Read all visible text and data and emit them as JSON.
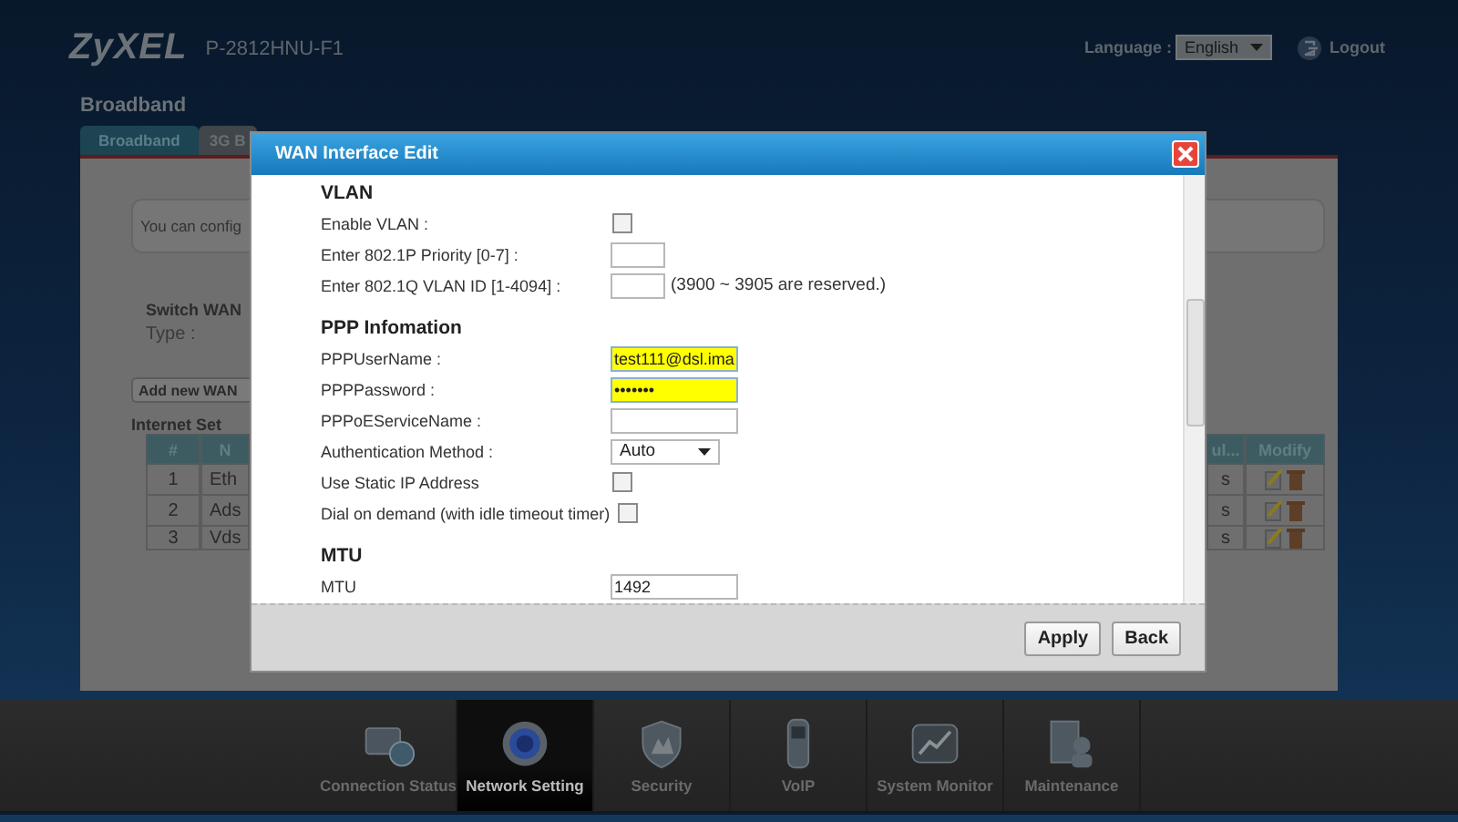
{
  "header": {
    "logo": "ZyXEL",
    "model": "P-2812HNU-F1",
    "language_label": "Language :",
    "language": "English",
    "logout": "Logout"
  },
  "page_title": "Broadband",
  "tabs": [
    {
      "label": "Broadband",
      "selected": true
    },
    {
      "label": "3G B",
      "selected": false
    }
  ],
  "background_panel": {
    "message": "You can config",
    "switch_heading": "Switch WAN",
    "type_label": "Type :",
    "add_button": "Add new WAN",
    "internet_heading": "Internet Set",
    "table": {
      "columns": [
        "#",
        "N",
        "ul...",
        "Modify"
      ],
      "rows": [
        {
          "number": "1",
          "name": "Eth",
          "status": "s"
        },
        {
          "number": "2",
          "name": "Ads",
          "status": "s"
        },
        {
          "number": "3",
          "name": "Vds",
          "status": "s"
        }
      ]
    }
  },
  "dialog": {
    "title": "WAN Interface Edit",
    "sections": [
      {
        "heading": "VLAN",
        "fields": [
          {
            "kind": "checkbox",
            "label": "Enable VLAN :",
            "checked": false
          },
          {
            "kind": "text",
            "label": "Enter 802.1P Priority [0-7] :"
          },
          {
            "kind": "text",
            "label": "Enter 802.1Q VLAN ID [1-4094] :",
            "note": "(3900 ~ 3905 are reserved.)"
          }
        ]
      },
      {
        "heading": "PPP Infomation",
        "fields": [
          {
            "kind": "text",
            "label": "PPPUserName :",
            "value": "test111@dsl.ima",
            "highlighted": true
          },
          {
            "kind": "password",
            "label": "PPPPassword :",
            "value": "•••••••",
            "highlighted": true
          },
          {
            "kind": "text",
            "label": "PPPoEServiceName :"
          },
          {
            "kind": "select",
            "label": "Authentication Method :",
            "value": "Auto"
          },
          {
            "kind": "checkbox",
            "label": "Use Static IP Address",
            "checked": false
          },
          {
            "kind": "checkbox",
            "label": "Dial on demand (with idle timeout timer)",
            "checked": false
          }
        ]
      },
      {
        "heading": "MTU",
        "fields": [
          {
            "kind": "text",
            "label": "MTU",
            "value": "1492"
          }
        ]
      }
    ],
    "buttons": [
      "Apply",
      "Back"
    ]
  },
  "nav": [
    {
      "label": "Connection Status",
      "selected": false
    },
    {
      "label": "Network Setting",
      "selected": true
    },
    {
      "label": "Security",
      "selected": false
    },
    {
      "label": "VoIP",
      "selected": false
    },
    {
      "label": "System Monitor",
      "selected": false
    },
    {
      "label": "Maintenance",
      "selected": false
    }
  ]
}
